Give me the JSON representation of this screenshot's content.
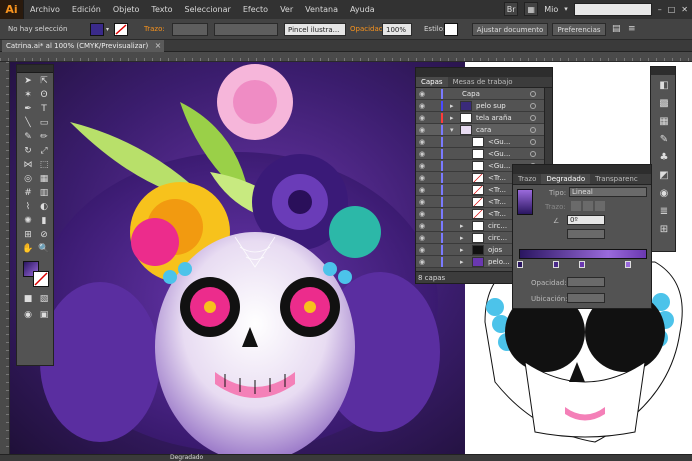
{
  "app": {
    "logo": "Ai"
  },
  "menu": {
    "items": [
      "Archivo",
      "Edición",
      "Objeto",
      "Texto",
      "Seleccionar",
      "Efecto",
      "Ver",
      "Ventana",
      "Ayuda"
    ],
    "user": "Mio"
  },
  "control_bar": {
    "selection_status": "No hay selección",
    "stroke_label": "Trazo:",
    "brush_label": "Pincel ilustra...",
    "opacity_label": "Opacidad:",
    "opacity_value": "100%",
    "style_label": "Estilo:",
    "adjust_doc": "Ajustar documento",
    "prefs": "Preferencias"
  },
  "document": {
    "tab_title": "Catrina.ai* al 100% (CMYK/Previsualizar)"
  },
  "status": {
    "panel_label": "Degradado"
  },
  "layers_panel": {
    "tabs": [
      "Capas",
      "Mesas de trabajo"
    ],
    "rows": [
      {
        "name": "Capa"
      },
      {
        "name": "pelo sup"
      },
      {
        "name": "tela araña"
      },
      {
        "name": "cara"
      },
      {
        "name": "<Gu..."
      },
      {
        "name": "<Gu..."
      },
      {
        "name": "<Gu..."
      },
      {
        "name": "<Tr..."
      },
      {
        "name": "<Tr..."
      },
      {
        "name": "<Tr..."
      },
      {
        "name": "<Tr..."
      },
      {
        "name": "circ..."
      },
      {
        "name": "circ..."
      },
      {
        "name": "ojos"
      },
      {
        "name": "pelo..."
      }
    ],
    "footer": "8 capas"
  },
  "gradient_panel": {
    "tabs": [
      "Trazo",
      "Degradado",
      "Transparenc"
    ],
    "type_label": "Tipo:",
    "type_value": "Lineal",
    "stroke_label": "Trazo:",
    "angle_value": "0º",
    "opacity_label": "Opacidad:",
    "location_label": "Ubicación:"
  },
  "colors": {
    "accent": "#f7931e",
    "gradient_start": "#2a1660",
    "gradient_end": "#9a6adc"
  }
}
